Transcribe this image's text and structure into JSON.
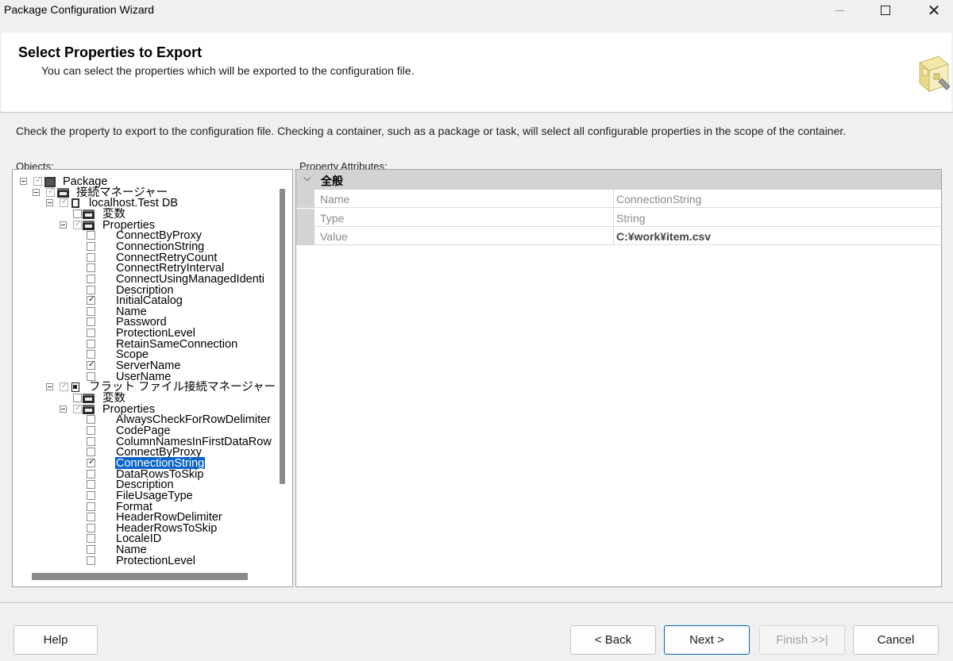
{
  "window": {
    "title": "Package Configuration Wizard"
  },
  "header": {
    "title": "Select Properties to Export",
    "subtitle": "You can select the properties which will be exported to the configuration file."
  },
  "instruction": "Check the property to export to the configuration file. Checking a container, such as a package or task, will select all configurable properties in the scope of the container.",
  "objects_label": "Objects:",
  "attributes_label": "Property Attributes:",
  "tree": [
    {
      "label": "Package",
      "level": 0,
      "expander": true,
      "checkbox": "checked-gray",
      "icon": "package-icon"
    },
    {
      "label": "接続マネージャー",
      "level": 1,
      "expander": true,
      "checkbox": "checked-gray",
      "icon": "folder-icon"
    },
    {
      "label": "localhost.Test DB",
      "level": 2,
      "expander": true,
      "checkbox": "checked-gray",
      "icon": "connection-icon"
    },
    {
      "label": "変数",
      "level": 3,
      "expander": false,
      "checkbox": "unchecked",
      "icon": "folder-icon"
    },
    {
      "label": "Properties",
      "level": 3,
      "expander": true,
      "checkbox": "checked-gray",
      "icon": "folder-icon"
    },
    {
      "label": "ConnectByProxy",
      "level": 4,
      "checkbox": "unchecked"
    },
    {
      "label": "ConnectionString",
      "level": 4,
      "checkbox": "unchecked"
    },
    {
      "label": "ConnectRetryCount",
      "level": 4,
      "checkbox": "unchecked"
    },
    {
      "label": "ConnectRetryInterval",
      "level": 4,
      "checkbox": "unchecked"
    },
    {
      "label": "ConnectUsingManagedIdenti",
      "level": 4,
      "checkbox": "unchecked"
    },
    {
      "label": "Description",
      "level": 4,
      "checkbox": "unchecked"
    },
    {
      "label": "InitialCatalog",
      "level": 4,
      "checkbox": "checked"
    },
    {
      "label": "Name",
      "level": 4,
      "checkbox": "unchecked"
    },
    {
      "label": "Password",
      "level": 4,
      "checkbox": "unchecked"
    },
    {
      "label": "ProtectionLevel",
      "level": 4,
      "checkbox": "unchecked"
    },
    {
      "label": "RetainSameConnection",
      "level": 4,
      "checkbox": "unchecked"
    },
    {
      "label": "Scope",
      "level": 4,
      "checkbox": "unchecked"
    },
    {
      "label": "ServerName",
      "level": 4,
      "checkbox": "checked"
    },
    {
      "label": "UserName",
      "level": 4,
      "checkbox": "unchecked"
    },
    {
      "label": "フラット ファイル接続マネージャー",
      "level": 2,
      "expander": true,
      "checkbox": "checked-gray",
      "icon": "file-icon"
    },
    {
      "label": "変数",
      "level": 3,
      "expander": false,
      "checkbox": "unchecked",
      "icon": "folder-icon"
    },
    {
      "label": "Properties",
      "level": 3,
      "expander": true,
      "checkbox": "checked-gray",
      "icon": "folder-icon"
    },
    {
      "label": "AlwaysCheckForRowDelimiter",
      "level": 4,
      "checkbox": "unchecked"
    },
    {
      "label": "CodePage",
      "level": 4,
      "checkbox": "unchecked"
    },
    {
      "label": "ColumnNamesInFirstDataRow",
      "level": 4,
      "checkbox": "unchecked"
    },
    {
      "label": "ConnectByProxy",
      "level": 4,
      "checkbox": "unchecked"
    },
    {
      "label": "ConnectionString",
      "level": 4,
      "checkbox": "checked",
      "selected": true
    },
    {
      "label": "DataRowsToSkip",
      "level": 4,
      "checkbox": "unchecked"
    },
    {
      "label": "Description",
      "level": 4,
      "checkbox": "unchecked"
    },
    {
      "label": "FileUsageType",
      "level": 4,
      "checkbox": "unchecked"
    },
    {
      "label": "Format",
      "level": 4,
      "checkbox": "unchecked"
    },
    {
      "label": "HeaderRowDelimiter",
      "level": 4,
      "checkbox": "unchecked"
    },
    {
      "label": "HeaderRowsToSkip",
      "level": 4,
      "checkbox": "unchecked"
    },
    {
      "label": "LocaleID",
      "level": 4,
      "checkbox": "unchecked"
    },
    {
      "label": "Name",
      "level": 4,
      "checkbox": "unchecked"
    },
    {
      "label": "ProtectionLevel",
      "level": 4,
      "checkbox": "unchecked"
    }
  ],
  "property_grid": {
    "category": "全般",
    "rows": [
      {
        "name": "Name",
        "value": "ConnectionString",
        "bold": false
      },
      {
        "name": "Type",
        "value": "String",
        "bold": false
      },
      {
        "name": "Value",
        "value": "C:¥work¥item.csv",
        "bold": true
      }
    ]
  },
  "buttons": {
    "help": "Help",
    "back": "< Back",
    "next": "Next >",
    "finish": "Finish >>|",
    "cancel": "Cancel"
  },
  "colors": {
    "selection": "#0b64c8",
    "primary_border": "#0067c0"
  }
}
